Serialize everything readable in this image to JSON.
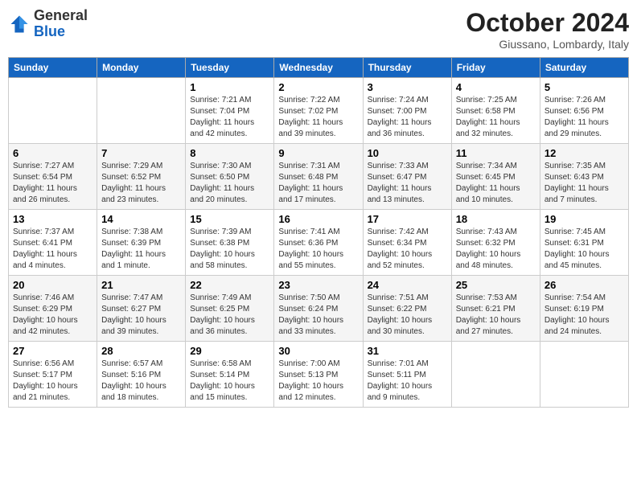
{
  "header": {
    "logo_general": "General",
    "logo_blue": "Blue",
    "month_title": "October 2024",
    "location": "Giussano, Lombardy, Italy"
  },
  "days_of_week": [
    "Sunday",
    "Monday",
    "Tuesday",
    "Wednesday",
    "Thursday",
    "Friday",
    "Saturday"
  ],
  "weeks": [
    [
      {
        "day": "",
        "info": ""
      },
      {
        "day": "",
        "info": ""
      },
      {
        "day": "1",
        "info": "Sunrise: 7:21 AM\nSunset: 7:04 PM\nDaylight: 11 hours and 42 minutes."
      },
      {
        "day": "2",
        "info": "Sunrise: 7:22 AM\nSunset: 7:02 PM\nDaylight: 11 hours and 39 minutes."
      },
      {
        "day": "3",
        "info": "Sunrise: 7:24 AM\nSunset: 7:00 PM\nDaylight: 11 hours and 36 minutes."
      },
      {
        "day": "4",
        "info": "Sunrise: 7:25 AM\nSunset: 6:58 PM\nDaylight: 11 hours and 32 minutes."
      },
      {
        "day": "5",
        "info": "Sunrise: 7:26 AM\nSunset: 6:56 PM\nDaylight: 11 hours and 29 minutes."
      }
    ],
    [
      {
        "day": "6",
        "info": "Sunrise: 7:27 AM\nSunset: 6:54 PM\nDaylight: 11 hours and 26 minutes."
      },
      {
        "day": "7",
        "info": "Sunrise: 7:29 AM\nSunset: 6:52 PM\nDaylight: 11 hours and 23 minutes."
      },
      {
        "day": "8",
        "info": "Sunrise: 7:30 AM\nSunset: 6:50 PM\nDaylight: 11 hours and 20 minutes."
      },
      {
        "day": "9",
        "info": "Sunrise: 7:31 AM\nSunset: 6:48 PM\nDaylight: 11 hours and 17 minutes."
      },
      {
        "day": "10",
        "info": "Sunrise: 7:33 AM\nSunset: 6:47 PM\nDaylight: 11 hours and 13 minutes."
      },
      {
        "day": "11",
        "info": "Sunrise: 7:34 AM\nSunset: 6:45 PM\nDaylight: 11 hours and 10 minutes."
      },
      {
        "day": "12",
        "info": "Sunrise: 7:35 AM\nSunset: 6:43 PM\nDaylight: 11 hours and 7 minutes."
      }
    ],
    [
      {
        "day": "13",
        "info": "Sunrise: 7:37 AM\nSunset: 6:41 PM\nDaylight: 11 hours and 4 minutes."
      },
      {
        "day": "14",
        "info": "Sunrise: 7:38 AM\nSunset: 6:39 PM\nDaylight: 11 hours and 1 minute."
      },
      {
        "day": "15",
        "info": "Sunrise: 7:39 AM\nSunset: 6:38 PM\nDaylight: 10 hours and 58 minutes."
      },
      {
        "day": "16",
        "info": "Sunrise: 7:41 AM\nSunset: 6:36 PM\nDaylight: 10 hours and 55 minutes."
      },
      {
        "day": "17",
        "info": "Sunrise: 7:42 AM\nSunset: 6:34 PM\nDaylight: 10 hours and 52 minutes."
      },
      {
        "day": "18",
        "info": "Sunrise: 7:43 AM\nSunset: 6:32 PM\nDaylight: 10 hours and 48 minutes."
      },
      {
        "day": "19",
        "info": "Sunrise: 7:45 AM\nSunset: 6:31 PM\nDaylight: 10 hours and 45 minutes."
      }
    ],
    [
      {
        "day": "20",
        "info": "Sunrise: 7:46 AM\nSunset: 6:29 PM\nDaylight: 10 hours and 42 minutes."
      },
      {
        "day": "21",
        "info": "Sunrise: 7:47 AM\nSunset: 6:27 PM\nDaylight: 10 hours and 39 minutes."
      },
      {
        "day": "22",
        "info": "Sunrise: 7:49 AM\nSunset: 6:25 PM\nDaylight: 10 hours and 36 minutes."
      },
      {
        "day": "23",
        "info": "Sunrise: 7:50 AM\nSunset: 6:24 PM\nDaylight: 10 hours and 33 minutes."
      },
      {
        "day": "24",
        "info": "Sunrise: 7:51 AM\nSunset: 6:22 PM\nDaylight: 10 hours and 30 minutes."
      },
      {
        "day": "25",
        "info": "Sunrise: 7:53 AM\nSunset: 6:21 PM\nDaylight: 10 hours and 27 minutes."
      },
      {
        "day": "26",
        "info": "Sunrise: 7:54 AM\nSunset: 6:19 PM\nDaylight: 10 hours and 24 minutes."
      }
    ],
    [
      {
        "day": "27",
        "info": "Sunrise: 6:56 AM\nSunset: 5:17 PM\nDaylight: 10 hours and 21 minutes."
      },
      {
        "day": "28",
        "info": "Sunrise: 6:57 AM\nSunset: 5:16 PM\nDaylight: 10 hours and 18 minutes."
      },
      {
        "day": "29",
        "info": "Sunrise: 6:58 AM\nSunset: 5:14 PM\nDaylight: 10 hours and 15 minutes."
      },
      {
        "day": "30",
        "info": "Sunrise: 7:00 AM\nSunset: 5:13 PM\nDaylight: 10 hours and 12 minutes."
      },
      {
        "day": "31",
        "info": "Sunrise: 7:01 AM\nSunset: 5:11 PM\nDaylight: 10 hours and 9 minutes."
      },
      {
        "day": "",
        "info": ""
      },
      {
        "day": "",
        "info": ""
      }
    ]
  ]
}
